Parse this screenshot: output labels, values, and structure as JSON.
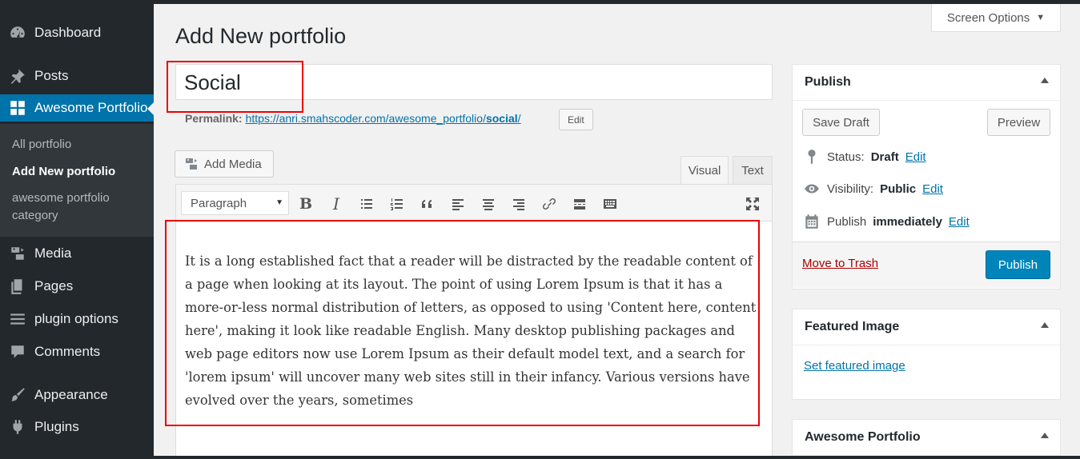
{
  "sidebar": {
    "items": [
      {
        "label": "Dashboard",
        "icon": "dashboard-icon"
      },
      {
        "label": "Posts",
        "icon": "pin-icon"
      },
      {
        "label": "Awesome Portfolio",
        "icon": "grid-icon"
      },
      {
        "label": "Media",
        "icon": "media-icon"
      },
      {
        "label": "Pages",
        "icon": "pages-icon"
      },
      {
        "label": "plugin options",
        "icon": "list-icon"
      },
      {
        "label": "Comments",
        "icon": "comment-icon"
      },
      {
        "label": "Appearance",
        "icon": "brush-icon"
      },
      {
        "label": "Plugins",
        "icon": "plugin-icon"
      }
    ],
    "submenu": [
      "All portfolio",
      "Add New portfolio",
      "awesome portfolio category"
    ]
  },
  "header": {
    "title": "Add New portfolio",
    "screen_options": "Screen Options"
  },
  "post": {
    "title": "Social",
    "permalink_label": "Permalink:",
    "permalink_base": "https://anri.smahscoder.com/awesome_portfolio/",
    "permalink_slug": "social",
    "permalink_trail": "/",
    "edit_label": "Edit"
  },
  "editor": {
    "add_media": "Add Media",
    "tab_visual": "Visual",
    "tab_text": "Text",
    "format": "Paragraph",
    "toolbar_bold": "B",
    "toolbar_italic": "I",
    "content": "It is a long established fact that a reader will be distracted by the readable content of a page when looking at its layout. The point of using Lorem Ipsum is that it has a more-or-less normal distribution of letters, as opposed to using 'Content here, content here', making it look like readable English. Many desktop publishing packages and web page editors now use Lorem Ipsum as their default model text, and a search for 'lorem ipsum' will uncover many web sites still in their infancy. Various versions have evolved over the years, sometimes"
  },
  "publish_box": {
    "title": "Publish",
    "save_draft": "Save Draft",
    "preview": "Preview",
    "status_label": "Status:",
    "status_value": "Draft",
    "visibility_label": "Visibility:",
    "visibility_value": "Public",
    "schedule_label": "Publish",
    "schedule_value": "immediately",
    "edit": "Edit",
    "trash": "Move to Trash",
    "publish": "Publish"
  },
  "featured_box": {
    "title": "Featured Image",
    "link": "Set featured image"
  },
  "portfolio_box": {
    "title": "Awesome Portfolio"
  },
  "colors": {
    "accent": "#0073aa",
    "primary_button": "#0085ba",
    "sidebar": "#23282d",
    "highlight_box": "#ee0000"
  }
}
